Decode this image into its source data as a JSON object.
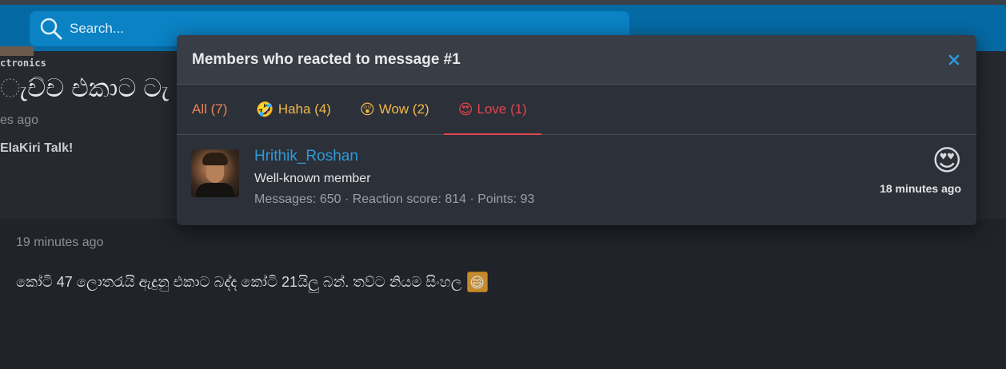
{
  "header": {
    "search_placeholder": "Search..."
  },
  "background": {
    "breadcrumb": "ctronics",
    "thread_title": "ැච්ච එකාට ටැ",
    "thread_ago": "es ago",
    "forum": "ElaKiri Talk!",
    "post_time": "19 minutes ago",
    "post_text": "කෝටි 47 ලොතරැයි ඇදුනු එකාට බද්ද කෝටි 21යිලු බන්. තව්ට නියම සිංහල",
    "post_emoji": "😄"
  },
  "modal": {
    "title": "Members who reacted to message #1",
    "close_icon": "close-icon",
    "tabs": [
      {
        "emoji": "",
        "label": "All (7)"
      },
      {
        "emoji": "🤣",
        "label": "Haha (4)"
      },
      {
        "emoji": "😲",
        "label": "Wow (2)"
      },
      {
        "emoji": "😍",
        "label": "Love (1)"
      }
    ],
    "active_tab": "Love (1)",
    "member": {
      "name": "Hrithik_Roshan",
      "user_title": "Well-known member",
      "stats": "Messages: 650 · Reaction score: 814 · Points: 93",
      "reaction_emoji": "😍",
      "time": "18 minutes ago"
    }
  },
  "colors": {
    "header_bg": "#056aa3",
    "accent_link": "#2e9ad8",
    "active_tab": "#e0454e",
    "tab_default": "#f0b84a"
  }
}
